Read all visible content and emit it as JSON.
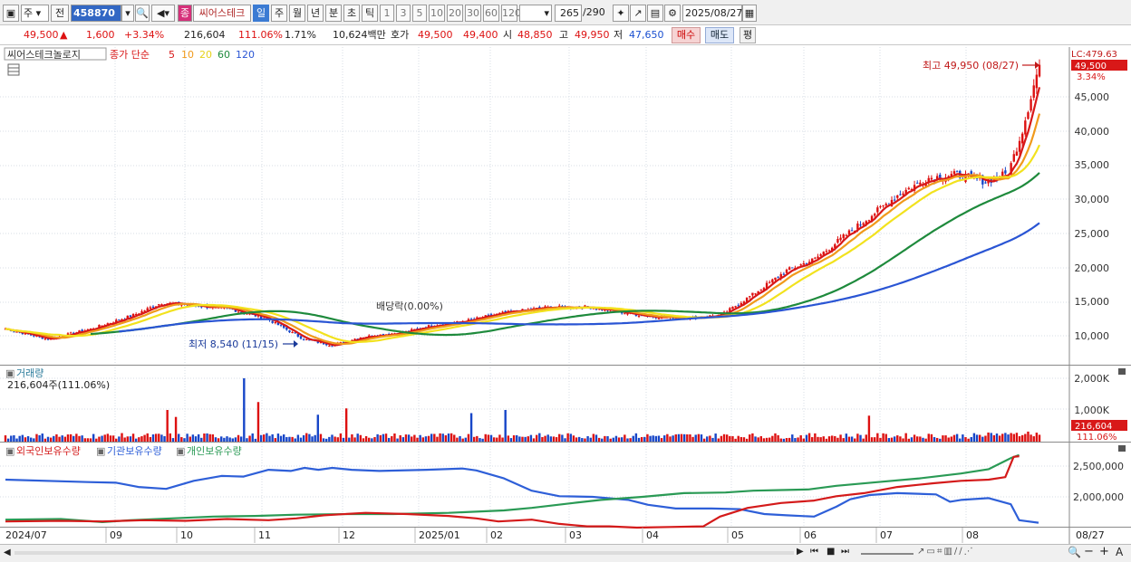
{
  "toolbar": {
    "market": "주",
    "market_alt": "전",
    "code": "458870",
    "stock_name": "씨어스테크",
    "badge": "종",
    "periods": [
      "일",
      "주",
      "월",
      "년",
      "분",
      "초",
      "틱"
    ],
    "intervals": [
      "1",
      "3",
      "5",
      "10",
      "20",
      "30",
      "60",
      "120"
    ],
    "count": "265",
    "count_total": "/290",
    "date": "2025/08/27"
  },
  "quote": {
    "price": "49,500",
    "arrow": "▲",
    "change": "1,600",
    "change_pct": "+3.34%",
    "volume": "216,604",
    "volume_ratio": "111.06%",
    "turnover": "1.71%",
    "amount": "10,624백만",
    "ask_label": "호가",
    "ask": "49,500",
    "bid": "49,400",
    "open_label": "시",
    "open": "48,850",
    "high_label": "고",
    "high": "49,950",
    "low_label": "저",
    "low": "47,650",
    "buy_btn": "매수",
    "sell_btn": "매도",
    "pl_btn": "평"
  },
  "price_panel": {
    "legend_name": "씨어스테크놀로지",
    "legend_ma": "종가 단순",
    "ma_periods": [
      "5",
      "10",
      "20",
      "60",
      "120"
    ],
    "ma_colors": [
      "#d81818",
      "#f09a1c",
      "#f2e21e",
      "#1e8a3c",
      "#2a55d4"
    ],
    "lc_label": "LC:479.63",
    "last_price_tag": "49,500",
    "last_pct_tag": "3.34%",
    "high_annot": "최고 49,950 (08/27)",
    "low_annot": "최저 8,540 (11/15)",
    "div_annot": "배당락(0.00%)",
    "y_ticks": [
      "45,000",
      "40,000",
      "35,000",
      "30,000",
      "25,000",
      "20,000",
      "15,000",
      "10,000"
    ]
  },
  "volume_panel": {
    "title": "거래량",
    "current": "216,604주(111.06%)",
    "y_ticks": [
      "2,000K",
      "1,000K"
    ],
    "last_tag": "216,604",
    "last_pct": "111.06%"
  },
  "holder_panel": {
    "series": [
      "외국인보유수량",
      "기관보유수량",
      "개인보유수량"
    ],
    "series_colors": [
      "#d41a1a",
      "#2e5fd8",
      "#2a9a55"
    ],
    "y_ticks": [
      "2,500,000",
      "2,000,000"
    ]
  },
  "x_axis": {
    "labels": [
      "2024/07",
      "09",
      "10",
      "11",
      "12",
      "2025/01",
      "02",
      "03",
      "04",
      "05",
      "06",
      "07",
      "08"
    ],
    "end_label": "08/27"
  },
  "chart_data": {
    "type": "line",
    "title": "",
    "x_range": [
      "2024/07",
      "2025/08/27"
    ],
    "ylim": [
      7500,
      50000
    ],
    "close_points": [
      [
        0,
        11000
      ],
      [
        15,
        9500
      ],
      [
        30,
        11000
      ],
      [
        45,
        13000
      ],
      [
        55,
        14800
      ],
      [
        65,
        14500
      ],
      [
        80,
        13800
      ],
      [
        92,
        12500
      ],
      [
        105,
        9500
      ],
      [
        115,
        8600
      ],
      [
        125,
        9800
      ],
      [
        140,
        10500
      ],
      [
        150,
        11500
      ],
      [
        160,
        12000
      ],
      [
        175,
        13300
      ],
      [
        190,
        14100
      ],
      [
        205,
        14200
      ],
      [
        220,
        13200
      ],
      [
        228,
        12800
      ],
      [
        240,
        12600
      ],
      [
        252,
        13000
      ],
      [
        263,
        16000
      ],
      [
        275,
        19500
      ],
      [
        285,
        21200
      ],
      [
        300,
        26000
      ],
      [
        315,
        30800
      ],
      [
        325,
        33000
      ],
      [
        335,
        33500
      ],
      [
        345,
        32500
      ],
      [
        353,
        33700
      ],
      [
        358,
        40000
      ],
      [
        362,
        46500
      ],
      [
        364,
        49500
      ]
    ],
    "ma_endpoints": {
      "5": 45000,
      "10": 39000,
      "20": 36000,
      "60": 29500,
      "120": 21800
    }
  }
}
